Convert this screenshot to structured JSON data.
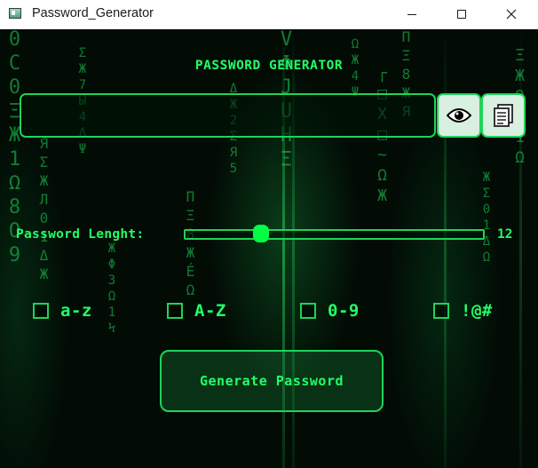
{
  "window": {
    "title": "Password_Generator",
    "controls": [
      "minimize",
      "maximize",
      "close"
    ]
  },
  "app": {
    "heading": "PASSWORD GENERATOR",
    "password": {
      "value": "",
      "placeholder": ""
    },
    "buttons": {
      "show": {
        "icon": "eye-icon"
      },
      "copy": {
        "icon": "clipboard-icon"
      },
      "generate_label": "Generate Password"
    },
    "length": {
      "label": "Password Lenght:",
      "value": "12",
      "slider_fraction": 0.25
    },
    "options": [
      {
        "label": "a-z",
        "checked": false
      },
      {
        "label": "A-Z",
        "checked": false
      },
      {
        "label": "0-9",
        "checked": false
      },
      {
        "label": "!@#",
        "checked": false
      }
    ]
  },
  "colors": {
    "accent": "#1fd35a",
    "text": "#22ff66",
    "thumb": "#00ff44",
    "background": "#020c05"
  }
}
